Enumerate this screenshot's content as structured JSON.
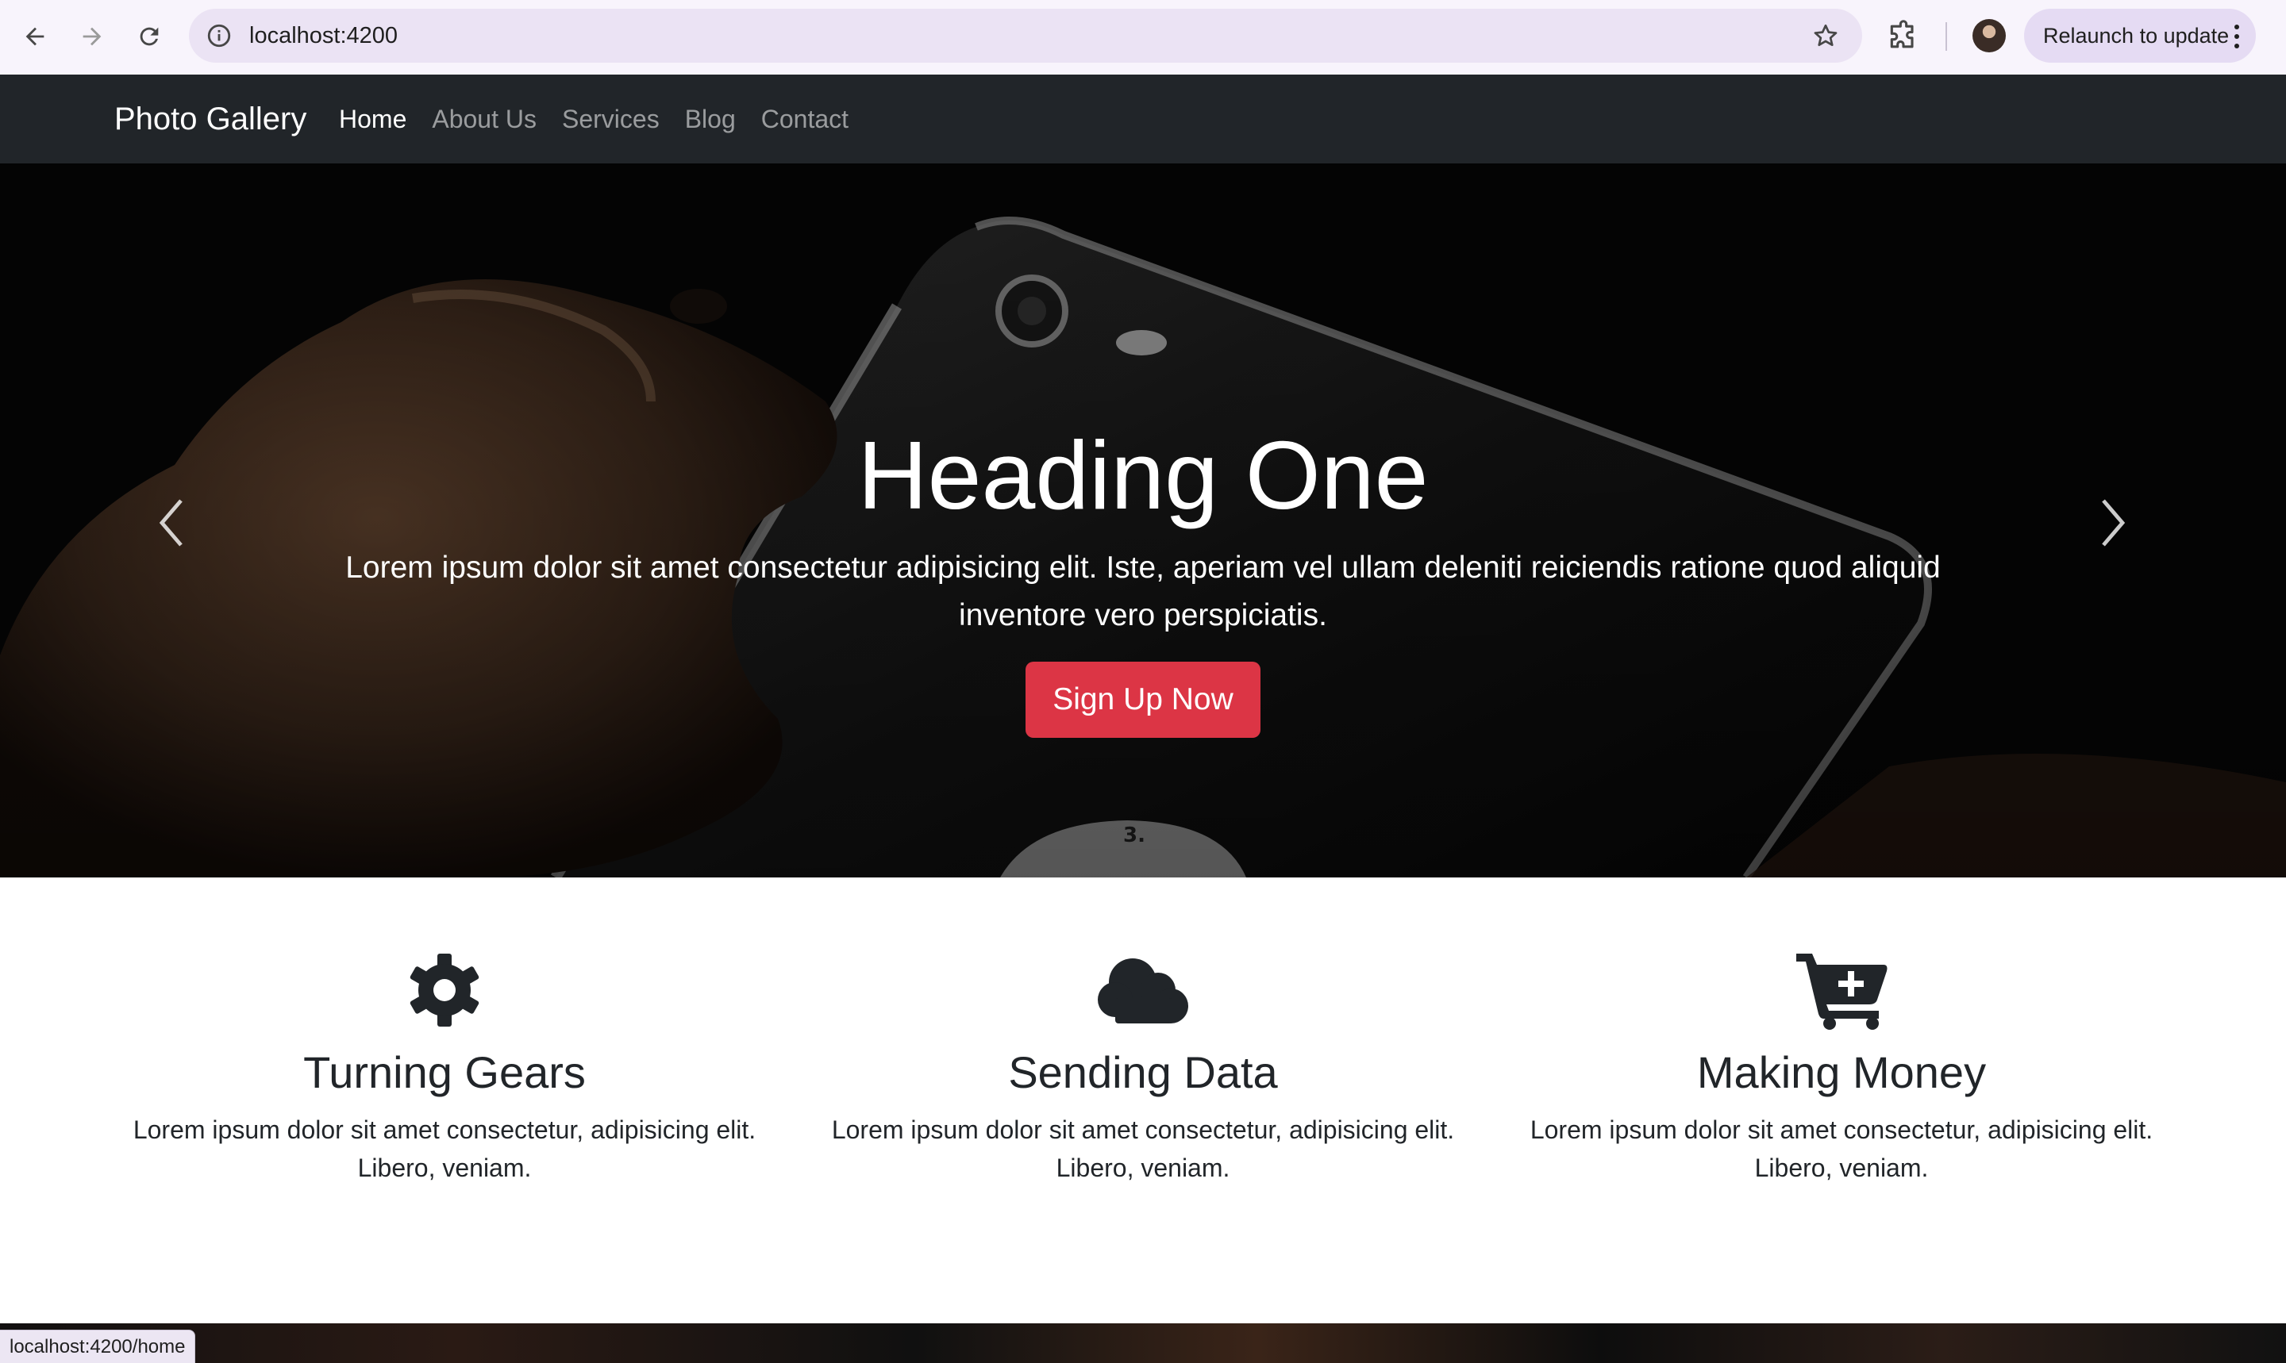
{
  "browser": {
    "url": "localhost:4200",
    "relaunch_label": "Relaunch to update",
    "status_url": "localhost:4200/home",
    "icons": [
      "back-icon",
      "forward-icon",
      "reload-icon",
      "site-info-icon",
      "bookmark-star-icon",
      "extensions-icon",
      "profile-avatar",
      "more-vert-icon"
    ]
  },
  "navbar": {
    "brand": "Photo Gallery",
    "links": [
      {
        "label": "Home",
        "active": true
      },
      {
        "label": "About Us",
        "active": false
      },
      {
        "label": "Services",
        "active": false
      },
      {
        "label": "Blog",
        "active": false
      },
      {
        "label": "Contact",
        "active": false
      }
    ]
  },
  "hero": {
    "heading": "Heading One",
    "text": "Lorem ipsum dolor sit amet consectetur adipisicing elit. Iste, aperiam vel ullam deleniti reiciendis ratione quod aliquid inventore vero perspiciatis.",
    "cta_label": "Sign Up Now",
    "cta_color": "#dc3545",
    "image_marking": "3."
  },
  "features": [
    {
      "icon": "gear-icon",
      "title": "Turning Gears",
      "text": "Lorem ipsum dolor sit amet consectetur, adipisicing elit. Libero, veniam."
    },
    {
      "icon": "cloud-icon",
      "title": "Sending Data",
      "text": "Lorem ipsum dolor sit amet consectetur, adipisicing elit. Libero, veniam."
    },
    {
      "icon": "cart-plus-icon",
      "title": "Making Money",
      "text": "Lorem ipsum dolor sit amet consectetur, adipisicing elit. Libero, veniam."
    }
  ],
  "colors": {
    "navbar_bg": "#212529",
    "chrome_bg": "#f8f4fc",
    "omnibox_bg": "#ebe3f4",
    "text_dark": "#212529"
  }
}
